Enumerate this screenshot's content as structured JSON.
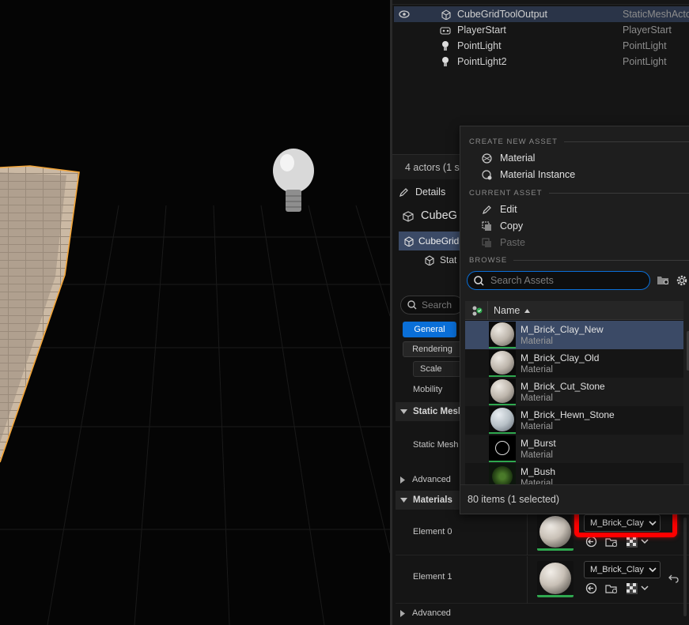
{
  "outliner": {
    "rows": [
      {
        "name": "CubeGridToolOutput",
        "type": "StaticMeshActor",
        "selected": true,
        "icon": "static-mesh-icon"
      },
      {
        "name": "PlayerStart",
        "type": "PlayerStart",
        "selected": false,
        "icon": "player-start-icon"
      },
      {
        "name": "PointLight",
        "type": "PointLight",
        "selected": false,
        "icon": "light-bulb-icon"
      },
      {
        "name": "PointLight2",
        "type": "PointLight",
        "selected": false,
        "icon": "light-bulb-icon"
      }
    ],
    "status": "4 actors (1 s"
  },
  "details": {
    "tab_label": "Details",
    "actor_name": "CubeG",
    "component_root": "CubeGrid",
    "component_child": "Stat",
    "search_placeholder": "Search",
    "filter_general": "General",
    "filter_rendering": "Rendering",
    "scale_label": "Scale",
    "mobility_label": "Mobility",
    "cat_static_mesh": "Static Mesh",
    "static_mesh_label": "Static Mesh",
    "advanced_label": "Advanced",
    "cat_materials": "Materials",
    "element0_label": "Element 0",
    "element0_value": "M_Brick_Clay",
    "element1_label": "Element 1",
    "element1_value": "M_Brick_Clay",
    "advanced2_label": "Advanced"
  },
  "popup": {
    "sec_create": "CREATE NEW ASSET",
    "item_material": "Material",
    "item_material_instance": "Material Instance",
    "sec_current": "CURRENT ASSET",
    "item_edit": "Edit",
    "item_copy": "Copy",
    "item_paste": "Paste",
    "sec_browse": "BROWSE",
    "search_placeholder": "Search Assets",
    "col_name": "Name",
    "assets": [
      {
        "name": "M_Brick_Clay_New",
        "kind": "Material",
        "selected": true
      },
      {
        "name": "M_Brick_Clay_Old",
        "kind": "Material",
        "selected": false
      },
      {
        "name": "M_Brick_Cut_Stone",
        "kind": "Material",
        "selected": false
      },
      {
        "name": "M_Brick_Hewn_Stone",
        "kind": "Material",
        "selected": false
      },
      {
        "name": "M_Burst",
        "kind": "Material",
        "selected": false
      },
      {
        "name": "M_Bush",
        "kind": "Material",
        "selected": false
      }
    ],
    "footer": "80 items (1 selected)"
  },
  "colors": {
    "selection": "#2a3448",
    "highlight": "#ff0000",
    "accent": "#0a6fd8",
    "outline": "#f2a53a"
  }
}
